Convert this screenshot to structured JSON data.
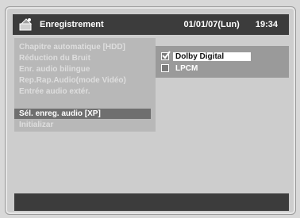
{
  "title_bar": {
    "title": "Enregistrement",
    "date": "01/01/07(Lun)",
    "time": "19:34",
    "icon": "recording-icon"
  },
  "menu": {
    "items": [
      {
        "label": "Chapitre automatique [HDD]"
      },
      {
        "label": "Réduction du Bruit"
      },
      {
        "label": "Enr. audio bilingue"
      },
      {
        "label": "Rep.Rap.Audio(mode Vidéo)"
      },
      {
        "label": "Entrée audio extér."
      },
      {
        "label": "Sél. enreg. audio [XP]",
        "selected": true
      },
      {
        "label": "Initializar"
      }
    ]
  },
  "submenu": {
    "items": [
      {
        "label": "Dolby Digital",
        "checked": true,
        "selected": true
      },
      {
        "label": "LPCM",
        "checked": false,
        "selected": false
      }
    ]
  },
  "colors": {
    "title_bar": "#3c3c3c",
    "selected_row": "#6f6f6f",
    "menu_panel": "#b8b8b8",
    "submenu_panel": "#9a9a9a"
  }
}
